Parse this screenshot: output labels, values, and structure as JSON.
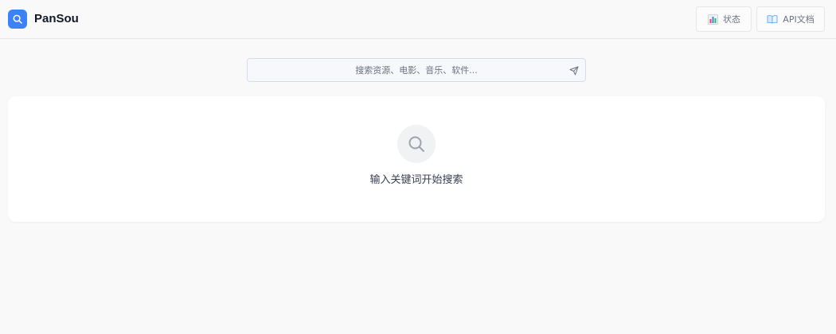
{
  "app": {
    "brand": "PanSou",
    "accent_color": "#3b82f6"
  },
  "header": {
    "logo_icon": "search-icon",
    "status_button": {
      "label": "状态",
      "icon": "bar-chart-icon"
    },
    "api_button": {
      "label": "API文档",
      "icon": "open-book-icon"
    }
  },
  "search": {
    "placeholder": "搜索资源、电影、音乐、软件...",
    "value": "",
    "submit_icon": "send-icon"
  },
  "empty_state": {
    "icon": "search-icon",
    "message": "输入关键词开始搜索"
  }
}
